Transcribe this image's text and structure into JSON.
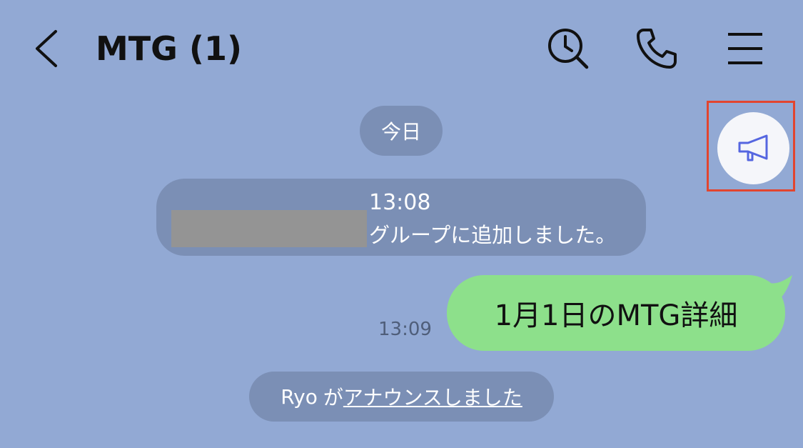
{
  "header": {
    "title": "MTG (1)",
    "icons": [
      "chevron-left-icon",
      "search-clock-icon",
      "phone-icon",
      "menu-icon"
    ]
  },
  "chat": {
    "date_label": "今日",
    "system_message": {
      "time": "13:08",
      "text": "グループに追加しました。"
    },
    "outgoing_message": {
      "time": "13:09",
      "text": "1月1日のMTG詳細",
      "bubble_color": "#8de08b"
    },
    "announcement_notice": {
      "actor": "Ryo",
      "particle": "が",
      "link_text": "アナウンスしました"
    }
  },
  "colors": {
    "background": "#92a9d4",
    "system_pill": "#7b8fb5",
    "highlight_frame": "#e2452f",
    "megaphone_icon": "#5566e0"
  }
}
